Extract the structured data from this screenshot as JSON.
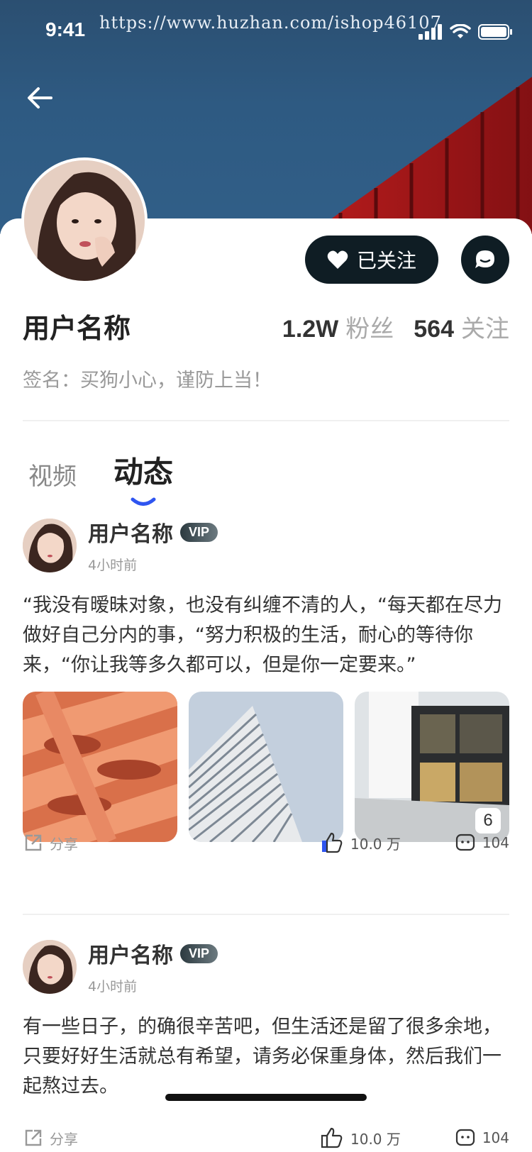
{
  "status_bar": {
    "time": "9:41",
    "watermark": "https://www.huzhan.com/ishop46107"
  },
  "profile": {
    "follow_label": "已关注",
    "username": "用户名称",
    "followers_count": "1.2W",
    "followers_label": "粉丝",
    "following_count": "564",
    "following_label": "关注",
    "signature": "签名：买狗小心，谨防上当！"
  },
  "tabs": [
    {
      "label": "视频",
      "active": false
    },
    {
      "label": "动态",
      "active": true
    }
  ],
  "posts": [
    {
      "author": "用户名称",
      "badge": "VIP",
      "time": "4小时前",
      "text": "“我没有暧昧对象，也没有纠缠不清的人，“每天都在尽力做好自己分内的事，“努力积极的生活，耐心的等待你来，“你让我等多久都可以，但是你一定要来。”",
      "image_count": "6",
      "share_label": "分享",
      "likes": "10.0 万",
      "comments": "104"
    },
    {
      "author": "用户名称",
      "badge": "VIP",
      "time": "4小时前",
      "text": "有一些日子，的确很辛苦吧，但生活还是留了很多余地，只要好好生活就总有希望，请务必保重身体，然后我们一起熬过去。",
      "share_label": "分享",
      "likes": "10.0 万",
      "comments": "104"
    }
  ],
  "colors": {
    "cover": "#2e5a82",
    "accent_blue": "#2f55f0",
    "button_dark": "#0f1d24",
    "stripe_red": "#b01c1c"
  }
}
